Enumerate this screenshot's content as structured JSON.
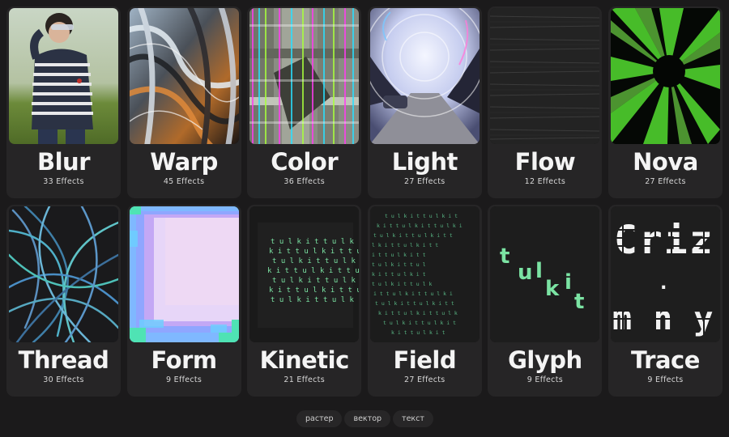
{
  "cards": [
    {
      "title": "Blur",
      "count": "33 Effects"
    },
    {
      "title": "Warp",
      "count": "45 Effects"
    },
    {
      "title": "Color",
      "count": "36 Effects"
    },
    {
      "title": "Light",
      "count": "27 Effects"
    },
    {
      "title": "Flow",
      "count": "12 Effects"
    },
    {
      "title": "Nova",
      "count": "27 Effects"
    },
    {
      "title": "Thread",
      "count": "30 Effects"
    },
    {
      "title": "Form",
      "count": "9 Effects"
    },
    {
      "title": "Kinetic",
      "count": "21 Effects"
    },
    {
      "title": "Field",
      "count": "27 Effects"
    },
    {
      "title": "Glyph",
      "count": "9 Effects"
    },
    {
      "title": "Trace",
      "count": "9 Effects"
    }
  ],
  "previews": {
    "kinetic_text": "tulkit",
    "field_letters": "tulkit",
    "glyph_letters": [
      "t",
      "u",
      "l",
      "k",
      "i",
      "t"
    ],
    "trace_text": [
      "Criz",
      ".",
      "m n y"
    ]
  },
  "tabs": [
    {
      "label": "растер"
    },
    {
      "label": "вектор"
    },
    {
      "label": "текст"
    }
  ],
  "colors": {
    "background": "#1b1a1b",
    "card": "#262526",
    "accent_green": "#7be3a3",
    "nova_green": "#5fe23a"
  }
}
